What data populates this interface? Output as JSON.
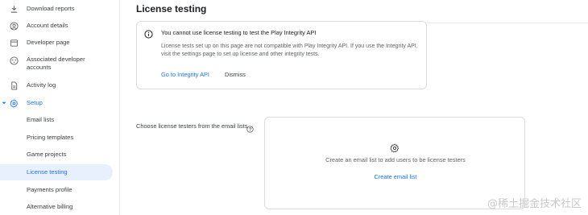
{
  "sidebar": {
    "items": [
      {
        "label": "Download reports",
        "icon": "download-icon"
      },
      {
        "label": "Account details",
        "icon": "account-circle-icon"
      },
      {
        "label": "Developer page",
        "icon": "web-page-icon"
      },
      {
        "label": "Associated developer accounts",
        "icon": "linked-accounts-icon"
      },
      {
        "label": "Activity log",
        "icon": "document-icon"
      },
      {
        "label": "Setup",
        "icon": "gear-icon"
      },
      {
        "label": "Email lists"
      },
      {
        "label": "Pricing templates"
      },
      {
        "label": "Game projects"
      },
      {
        "label": "License testing"
      },
      {
        "label": "Payments profile"
      },
      {
        "label": "Alternative billing"
      }
    ],
    "selected": "License testing"
  },
  "main": {
    "title": "License testing",
    "banner": {
      "title": "You cannot use license testing to test the Play Integrity API",
      "body": "License tests set up on this page are not compatible with Play Integrity API. If you use the Integrity API, visit the settings page to set up license and other integrity tests.",
      "primary_action": "Go to Integrity API",
      "secondary_action": "Dismiss"
    },
    "field_label": "Choose license testers from the email lists",
    "empty_state": {
      "text": "Create an email list to add users to be license testers",
      "action": "Create email list"
    }
  },
  "watermark": "@稀土掘金技术社区",
  "colors": {
    "accent": "#1a73e8",
    "selected_bg": "#e8f0fe",
    "border": "#dadce0"
  }
}
